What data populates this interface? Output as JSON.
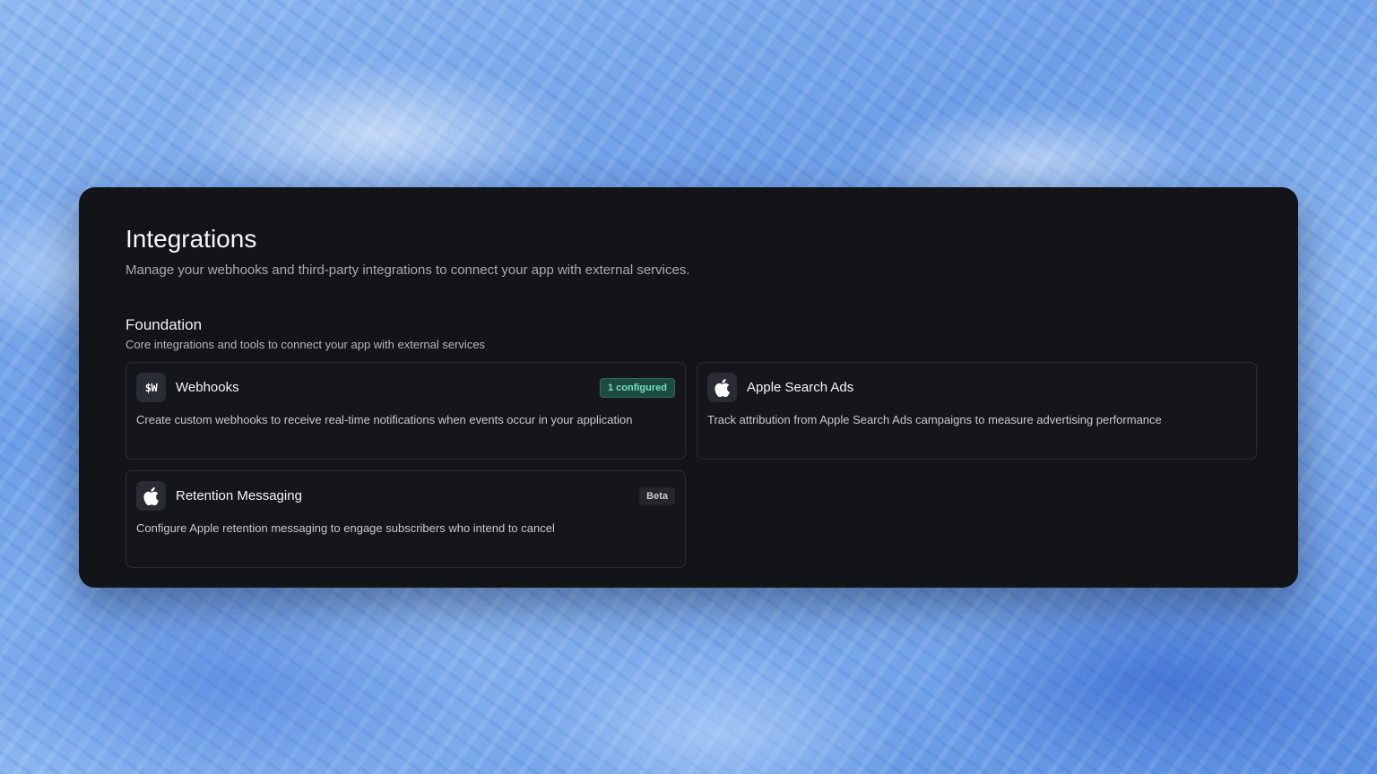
{
  "page": {
    "title": "Integrations",
    "subtitle": "Manage your webhooks and third-party integrations to connect your app with external services."
  },
  "section": {
    "title": "Foundation",
    "subtitle": "Core integrations and tools to connect your app with external services"
  },
  "integrations": [
    {
      "name": "Webhooks",
      "icon_text": "$W",
      "icon": "webhooks-logo-icon",
      "badge": "1 configured",
      "description": "Create custom webhooks to receive real-time notifications when events occur in your application"
    },
    {
      "name": "Apple Search Ads",
      "icon": "apple-icon",
      "badge": "",
      "description": "Track attribution from Apple Search Ads campaigns to measure advertising performance"
    },
    {
      "name": "Retention Messaging",
      "icon": "apple-icon",
      "badge": "Beta",
      "description": "Configure Apple retention messaging to engage subscribers who intend to cancel"
    }
  ],
  "colors": {
    "panel_bg": "#131418",
    "badge_configured_text": "#6fe3bd",
    "badge_configured_bg": "#1f4a40"
  }
}
